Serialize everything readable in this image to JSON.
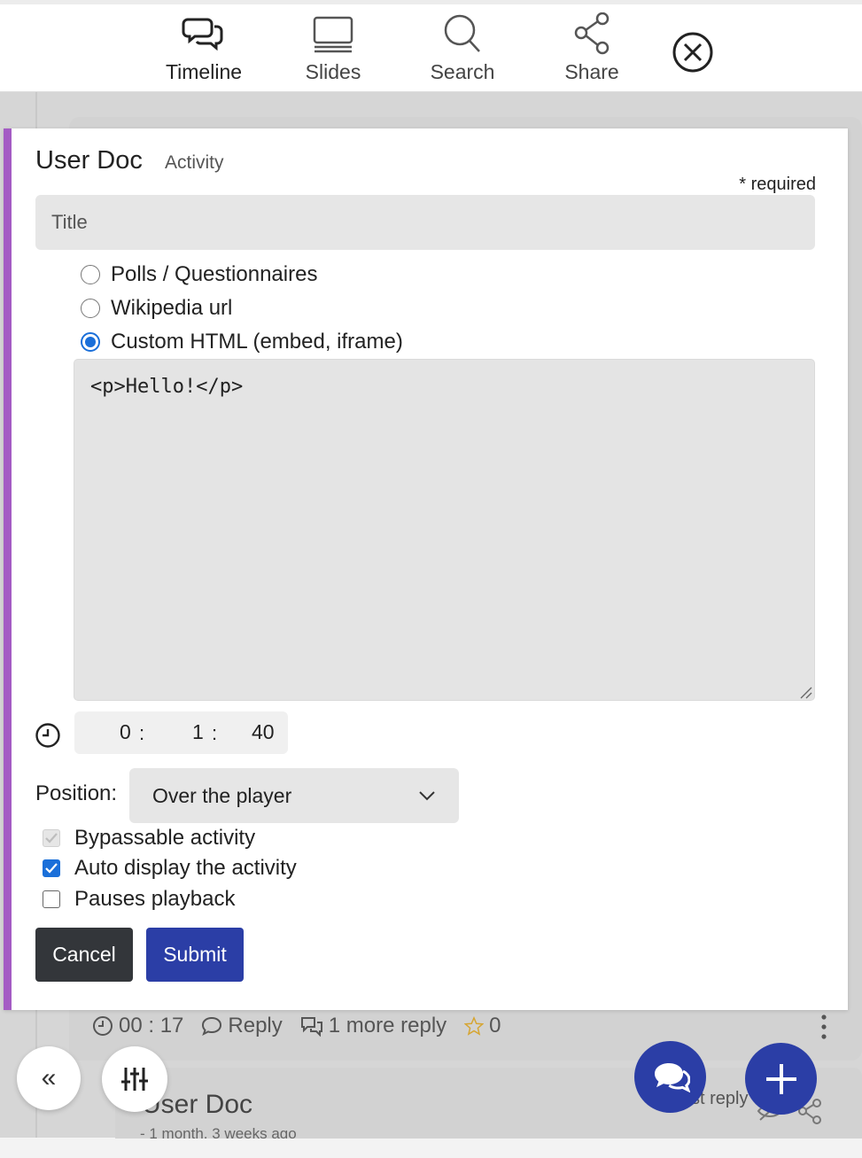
{
  "nav": {
    "items": [
      {
        "label": "Timeline",
        "icon": "chat-bubbles-icon",
        "active": true
      },
      {
        "label": "Slides",
        "icon": "slides-icon",
        "active": false
      },
      {
        "label": "Search",
        "icon": "search-icon",
        "active": false
      },
      {
        "label": "Share",
        "icon": "share-icon",
        "active": false
      }
    ],
    "close_icon": "close-circle-icon"
  },
  "modal": {
    "title": "User Doc",
    "subtitle": "Activity",
    "required_note": "* required",
    "title_placeholder": "Title",
    "activity_types": [
      {
        "label": "Polls / Questionnaires",
        "selected": false
      },
      {
        "label": "Wikipedia url",
        "selected": false
      },
      {
        "label": "Custom HTML (embed, iframe)",
        "selected": true
      }
    ],
    "html_content": "<p>Hello!</p>",
    "time": {
      "hours": "0",
      "minutes": "1",
      "seconds": "40",
      "sep": ":"
    },
    "position_label": "Position:",
    "position_value": "Over the player",
    "options": [
      {
        "label": "Bypassable activity",
        "checked": true,
        "disabled": true
      },
      {
        "label": "Auto display the activity",
        "checked": true,
        "disabled": false
      },
      {
        "label": "Pauses playback",
        "checked": false,
        "disabled": false
      }
    ],
    "cancel_label": "Cancel",
    "submit_label": "Submit",
    "accent_color": "#a45cc4",
    "primary_color": "#2b3ea6"
  },
  "background": {
    "timestamp": "00 : 17",
    "reply_label": "Reply",
    "more_replies": "1 more reply",
    "stars": "0",
    "next_title": "User Doc",
    "next_sub": "- 1 month, 3 weeks ago",
    "next_reply_partial": "st reply"
  },
  "fabs": {
    "collapse_icon": "«"
  }
}
